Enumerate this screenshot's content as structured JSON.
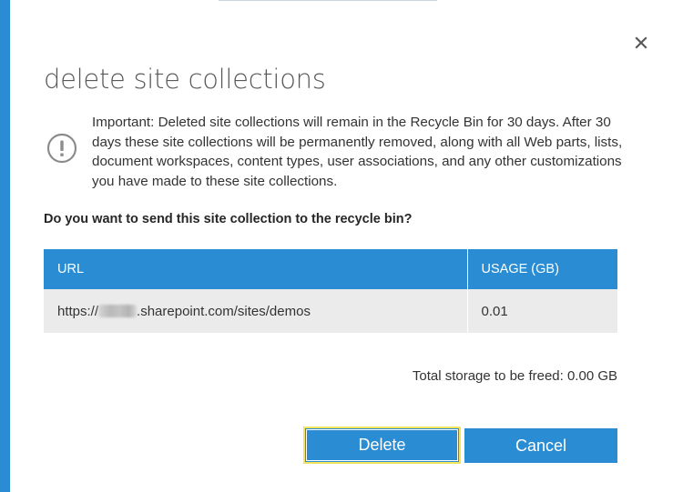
{
  "dialog": {
    "title": "delete site collections",
    "close_icon": "close-icon"
  },
  "notice": {
    "icon": "exclamation-circle-icon",
    "text": "Important: Deleted site collections will remain in the Recycle Bin for 30 days. After 30 days these site collections will be permanently removed, along with all Web parts, lists, document workspaces, content types, user associations, and any other customizations you have made to these site collections."
  },
  "question": "Do you want to send this site collection to the recycle bin?",
  "table": {
    "headers": {
      "url": "URL",
      "usage": "USAGE (GB)"
    },
    "rows": [
      {
        "url_prefix": "https://",
        "url_suffix": ".sharepoint.com/sites/demos",
        "usage": "0.01"
      }
    ]
  },
  "total_storage": "Total storage to be freed: 0.00 GB",
  "buttons": {
    "delete": "Delete",
    "cancel": "Cancel"
  },
  "colors": {
    "accent": "#2a8dd4",
    "focus_border": "#f2e45c",
    "row_bg": "#ebebeb"
  }
}
